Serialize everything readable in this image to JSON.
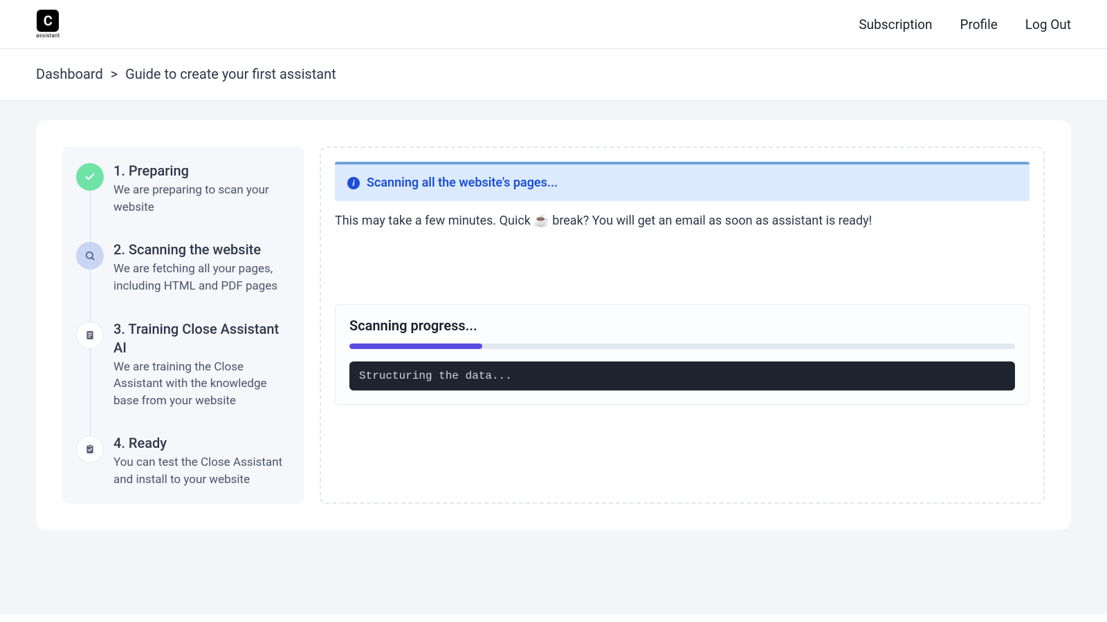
{
  "brand": {
    "glyph": "C",
    "sub": "assistant"
  },
  "nav": {
    "subscription": "Subscription",
    "profile": "Profile",
    "logout": "Log Out"
  },
  "breadcrumb": {
    "root": "Dashboard",
    "page": "Guide to create your first assistant"
  },
  "steps": [
    {
      "title": "1. Preparing",
      "desc": "We are preparing to scan your website",
      "state": "done"
    },
    {
      "title": "2. Scanning the website",
      "desc": "We are fetching all your pages, including HTML and PDF pages",
      "state": "active"
    },
    {
      "title": "3. Training Close Assistant AI",
      "desc": "We are training the Close Assistant with the knowledge base from your website",
      "state": "pending"
    },
    {
      "title": "4. Ready",
      "desc": "You can test the Close Assistant and install to your website",
      "state": "pending"
    }
  ],
  "info": {
    "message": "Scanning all the website's pages..."
  },
  "hint": "This may take a few minutes. Quick ☕ break? You will get an email as soon as assistant is ready!",
  "progress": {
    "title": "Scanning progress...",
    "percent": 20,
    "status_line": "Structuring the data..."
  },
  "colors": {
    "accent": "#5b4ce0",
    "info_bg": "#dbeafe",
    "info_text": "#1d4ed8",
    "done": "#6fe3a6"
  }
}
